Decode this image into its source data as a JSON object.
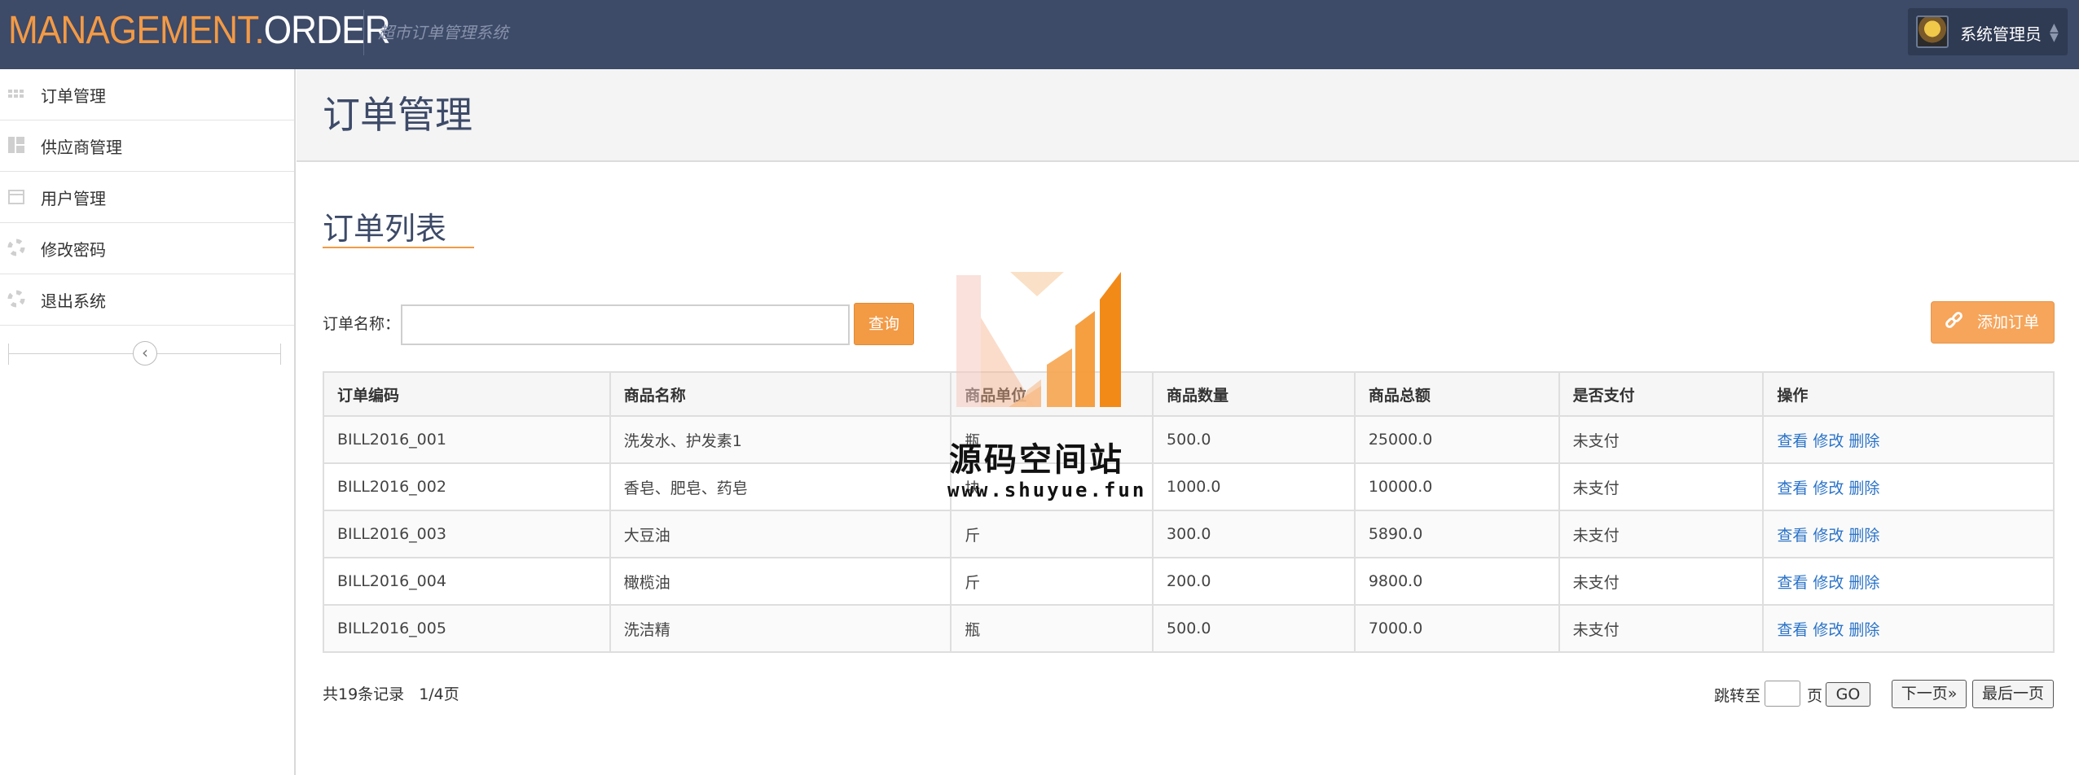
{
  "header": {
    "brand_part1": "MANAGEMENT.",
    "brand_part2": "ORDER",
    "subtitle": "超市订单管理系统",
    "user_name": "系统管理员"
  },
  "sidebar": {
    "items": [
      {
        "label": "订单管理",
        "icon": "grid-icon"
      },
      {
        "label": "供应商管理",
        "icon": "dashboard-icon"
      },
      {
        "label": "用户管理",
        "icon": "calendar-icon"
      },
      {
        "label": "修改密码",
        "icon": "lifebuoy-icon"
      },
      {
        "label": "退出系统",
        "icon": "lifebuoy-icon"
      }
    ],
    "collapse_icon": "chevron-left-icon"
  },
  "main": {
    "page_title": "订单管理",
    "section_title": "订单列表",
    "search": {
      "label": "订单名称：",
      "value": "",
      "button": "查询"
    },
    "add_button": "添加订单",
    "table": {
      "headers": [
        "订单编码",
        "商品名称",
        "商品单位",
        "商品数量",
        "商品总额",
        "是否支付",
        "操作"
      ],
      "rows": [
        [
          "BILL2016_001",
          "洗发水、护发素1",
          "瓶",
          "500.0",
          "25000.0",
          "未支付"
        ],
        [
          "BILL2016_002",
          "香皂、肥皂、药皂",
          "块",
          "1000.0",
          "10000.0",
          "未支付"
        ],
        [
          "BILL2016_003",
          "大豆油",
          "斤",
          "300.0",
          "5890.0",
          "未支付"
        ],
        [
          "BILL2016_004",
          "橄榄油",
          "斤",
          "200.0",
          "9800.0",
          "未支付"
        ],
        [
          "BILL2016_005",
          "洗洁精",
          "瓶",
          "500.0",
          "7000.0",
          "未支付"
        ]
      ],
      "actions": [
        "查看",
        "修改",
        "删除"
      ]
    },
    "pager": {
      "total_records": "共19条记录",
      "page_info": "1/4页",
      "jump_label": "跳转至",
      "jump_value": "",
      "page_unit": "页",
      "go": "GO",
      "next": "下一页»",
      "last": "最后一页"
    }
  },
  "watermark": {
    "text": "源码空间站",
    "url": "www.shuyue.fun"
  },
  "colors": {
    "header_bg": "#3d4a68",
    "accent": "#f39a45",
    "link": "#2a73c8"
  }
}
